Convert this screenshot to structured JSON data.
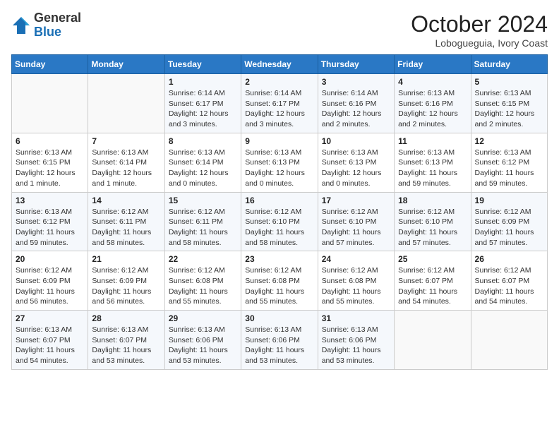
{
  "logo": {
    "general": "General",
    "blue": "Blue"
  },
  "header": {
    "month": "October 2024",
    "location": "Lobogueguia, Ivory Coast"
  },
  "weekdays": [
    "Sunday",
    "Monday",
    "Tuesday",
    "Wednesday",
    "Thursday",
    "Friday",
    "Saturday"
  ],
  "weeks": [
    [
      {
        "day": "",
        "info": ""
      },
      {
        "day": "",
        "info": ""
      },
      {
        "day": "1",
        "info": "Sunrise: 6:14 AM\nSunset: 6:17 PM\nDaylight: 12 hours and 3 minutes."
      },
      {
        "day": "2",
        "info": "Sunrise: 6:14 AM\nSunset: 6:17 PM\nDaylight: 12 hours and 3 minutes."
      },
      {
        "day": "3",
        "info": "Sunrise: 6:14 AM\nSunset: 6:16 PM\nDaylight: 12 hours and 2 minutes."
      },
      {
        "day": "4",
        "info": "Sunrise: 6:13 AM\nSunset: 6:16 PM\nDaylight: 12 hours and 2 minutes."
      },
      {
        "day": "5",
        "info": "Sunrise: 6:13 AM\nSunset: 6:15 PM\nDaylight: 12 hours and 2 minutes."
      }
    ],
    [
      {
        "day": "6",
        "info": "Sunrise: 6:13 AM\nSunset: 6:15 PM\nDaylight: 12 hours and 1 minute."
      },
      {
        "day": "7",
        "info": "Sunrise: 6:13 AM\nSunset: 6:14 PM\nDaylight: 12 hours and 1 minute."
      },
      {
        "day": "8",
        "info": "Sunrise: 6:13 AM\nSunset: 6:14 PM\nDaylight: 12 hours and 0 minutes."
      },
      {
        "day": "9",
        "info": "Sunrise: 6:13 AM\nSunset: 6:13 PM\nDaylight: 12 hours and 0 minutes."
      },
      {
        "day": "10",
        "info": "Sunrise: 6:13 AM\nSunset: 6:13 PM\nDaylight: 12 hours and 0 minutes."
      },
      {
        "day": "11",
        "info": "Sunrise: 6:13 AM\nSunset: 6:13 PM\nDaylight: 11 hours and 59 minutes."
      },
      {
        "day": "12",
        "info": "Sunrise: 6:13 AM\nSunset: 6:12 PM\nDaylight: 11 hours and 59 minutes."
      }
    ],
    [
      {
        "day": "13",
        "info": "Sunrise: 6:13 AM\nSunset: 6:12 PM\nDaylight: 11 hours and 59 minutes."
      },
      {
        "day": "14",
        "info": "Sunrise: 6:12 AM\nSunset: 6:11 PM\nDaylight: 11 hours and 58 minutes."
      },
      {
        "day": "15",
        "info": "Sunrise: 6:12 AM\nSunset: 6:11 PM\nDaylight: 11 hours and 58 minutes."
      },
      {
        "day": "16",
        "info": "Sunrise: 6:12 AM\nSunset: 6:10 PM\nDaylight: 11 hours and 58 minutes."
      },
      {
        "day": "17",
        "info": "Sunrise: 6:12 AM\nSunset: 6:10 PM\nDaylight: 11 hours and 57 minutes."
      },
      {
        "day": "18",
        "info": "Sunrise: 6:12 AM\nSunset: 6:10 PM\nDaylight: 11 hours and 57 minutes."
      },
      {
        "day": "19",
        "info": "Sunrise: 6:12 AM\nSunset: 6:09 PM\nDaylight: 11 hours and 57 minutes."
      }
    ],
    [
      {
        "day": "20",
        "info": "Sunrise: 6:12 AM\nSunset: 6:09 PM\nDaylight: 11 hours and 56 minutes."
      },
      {
        "day": "21",
        "info": "Sunrise: 6:12 AM\nSunset: 6:09 PM\nDaylight: 11 hours and 56 minutes."
      },
      {
        "day": "22",
        "info": "Sunrise: 6:12 AM\nSunset: 6:08 PM\nDaylight: 11 hours and 55 minutes."
      },
      {
        "day": "23",
        "info": "Sunrise: 6:12 AM\nSunset: 6:08 PM\nDaylight: 11 hours and 55 minutes."
      },
      {
        "day": "24",
        "info": "Sunrise: 6:12 AM\nSunset: 6:08 PM\nDaylight: 11 hours and 55 minutes."
      },
      {
        "day": "25",
        "info": "Sunrise: 6:12 AM\nSunset: 6:07 PM\nDaylight: 11 hours and 54 minutes."
      },
      {
        "day": "26",
        "info": "Sunrise: 6:12 AM\nSunset: 6:07 PM\nDaylight: 11 hours and 54 minutes."
      }
    ],
    [
      {
        "day": "27",
        "info": "Sunrise: 6:13 AM\nSunset: 6:07 PM\nDaylight: 11 hours and 54 minutes."
      },
      {
        "day": "28",
        "info": "Sunrise: 6:13 AM\nSunset: 6:07 PM\nDaylight: 11 hours and 53 minutes."
      },
      {
        "day": "29",
        "info": "Sunrise: 6:13 AM\nSunset: 6:06 PM\nDaylight: 11 hours and 53 minutes."
      },
      {
        "day": "30",
        "info": "Sunrise: 6:13 AM\nSunset: 6:06 PM\nDaylight: 11 hours and 53 minutes."
      },
      {
        "day": "31",
        "info": "Sunrise: 6:13 AM\nSunset: 6:06 PM\nDaylight: 11 hours and 53 minutes."
      },
      {
        "day": "",
        "info": ""
      },
      {
        "day": "",
        "info": ""
      }
    ]
  ]
}
